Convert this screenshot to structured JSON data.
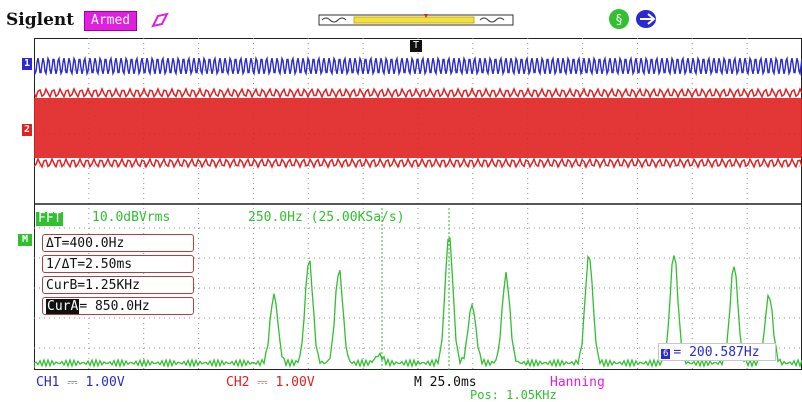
{
  "header": {
    "brand": "Siglent",
    "status": "Armed"
  },
  "markers": {
    "ch1": "1",
    "ch2": "2",
    "math": "M",
    "trigger": "T"
  },
  "fft": {
    "label": "FFT",
    "vertical_scale": "10.0dBVrms",
    "horizontal_scale": "250.0Hz (25.00KSa/s)",
    "window": "Hanning"
  },
  "cursors": {
    "delta": "ΔT=400.0Hz",
    "inverse": "1/ΔT=2.50ms",
    "cur_b": "CurB=1.25KHz",
    "cur_a_tag": "CurA",
    "cur_a_value": "= 850.0Hz",
    "readout_tag": "6",
    "readout": "= 200.587Hz"
  },
  "footer": {
    "ch1": "CH1 ⎓ 1.00V",
    "ch2": "CH2 ⎓ 1.00V",
    "timebase": "M 25.0ms",
    "position": "Pos: 1.05KHz"
  },
  "colors": {
    "ch1": "#2a2ad0",
    "ch2": "#e02020",
    "math": "#30c030",
    "accent": "#e020e0"
  },
  "icons": [
    "trigger-icon",
    "memory-depth-icon",
    "ok-status-icon",
    "usb-icon"
  ]
}
